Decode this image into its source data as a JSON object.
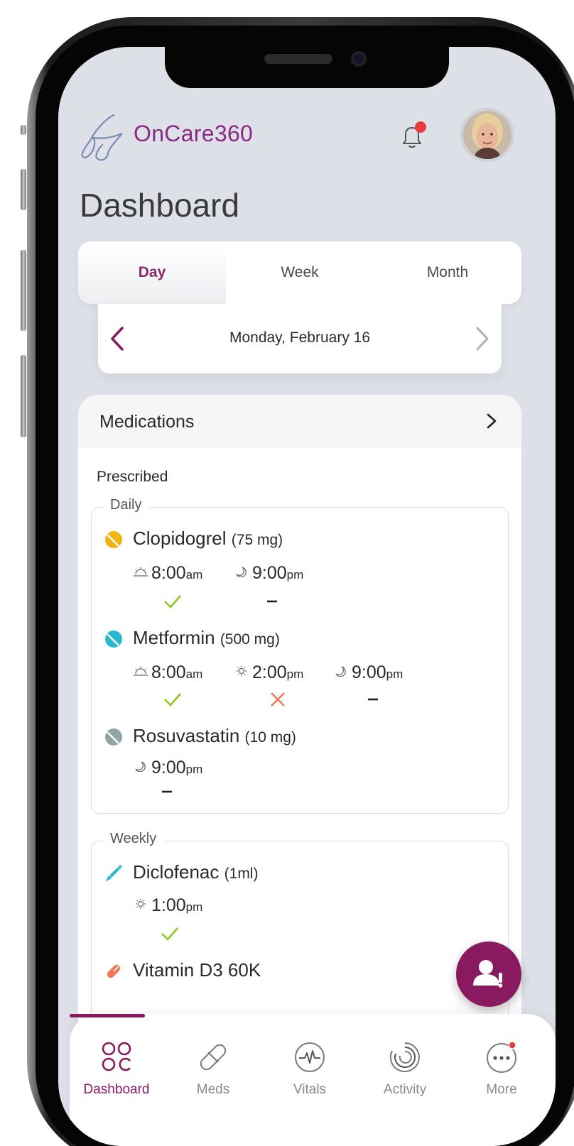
{
  "app": {
    "brand": "OnCare360"
  },
  "header": {
    "title": "Dashboard",
    "notification_icon": "bell-icon",
    "has_unread": true
  },
  "range_tabs": [
    {
      "label": "Day",
      "active": true
    },
    {
      "label": "Week",
      "active": false
    },
    {
      "label": "Month",
      "active": false
    }
  ],
  "date_nav": {
    "date": "Monday, February 16"
  },
  "medications": {
    "title": "Medications",
    "section": "Prescribed",
    "daily_label": "Daily",
    "weekly_label": "Weekly",
    "daily": [
      {
        "name": "Clopidogrel",
        "dose": "(75 mg)",
        "icon_color": "#f0b417",
        "times": [
          {
            "time": "8:00",
            "period": "am",
            "tod": "sunrise-icon",
            "status": "taken"
          },
          {
            "time": "9:00",
            "period": "pm",
            "tod": "moon-icon",
            "status": "pending"
          }
        ]
      },
      {
        "name": "Metformin",
        "dose": "(500 mg)",
        "icon_color": "#2bb7cf",
        "times": [
          {
            "time": "8:00",
            "period": "am",
            "tod": "sunrise-icon",
            "status": "taken"
          },
          {
            "time": "2:00",
            "period": "pm",
            "tod": "sun-icon",
            "status": "missed"
          },
          {
            "time": "9:00",
            "period": "pm",
            "tod": "moon-icon",
            "status": "pending"
          }
        ]
      },
      {
        "name": "Rosuvastatin",
        "dose": "(10 mg)",
        "icon_color": "#8ea7a4",
        "times": [
          {
            "time": "9:00",
            "period": "pm",
            "tod": "moon-icon",
            "status": "pending"
          }
        ]
      }
    ],
    "weekly": [
      {
        "name": "Diclofenac",
        "dose": "(1ml)",
        "icon": "syringe-icon",
        "times": [
          {
            "time": "1:00",
            "period": "pm",
            "tod": "sun-icon",
            "status": "taken"
          }
        ]
      },
      {
        "name": "Vitamin D3 60K",
        "dose": "",
        "icon": "capsule-icon"
      }
    ]
  },
  "status_colors": {
    "taken": "#8ccb1f",
    "missed": "#f07850",
    "accent": "#8a1a60"
  },
  "bottom_nav": [
    {
      "label": "Dashboard",
      "icon": "grid-icon",
      "active": true
    },
    {
      "label": "Meds",
      "icon": "pill-icon",
      "active": false
    },
    {
      "label": "Vitals",
      "icon": "heartbeat-icon",
      "active": false
    },
    {
      "label": "Activity",
      "icon": "activity-ring-icon",
      "active": false
    },
    {
      "label": "More",
      "icon": "more-icon",
      "active": false
    }
  ]
}
